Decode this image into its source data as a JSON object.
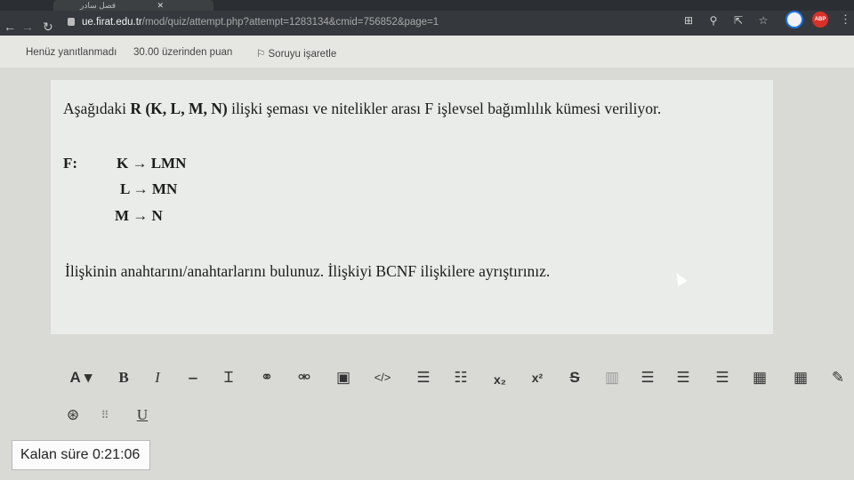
{
  "browser": {
    "tab_title": "فصل سادر",
    "url_host": "ue.firat.edu.tr",
    "url_path": "/mod/quiz/attempt.php?attempt=1283134&cmid=756852&page=1",
    "abp_label": "ABP"
  },
  "question_info": {
    "status": "Henüz yanıtlanmadı",
    "points": "30.00 üzerinden puan",
    "flag": "Soruyu işaretle"
  },
  "question": {
    "intro_before": "Aşağıdaki ",
    "intro_schema": "R (K, L, M, N)",
    "intro_after": " ilişki şeması ve nitelikler arası F işlevsel bağımlılık kümesi veriliyor.",
    "f_label": "F:",
    "dependencies": [
      "K → LMN",
      "L → MN",
      "M → N"
    ],
    "task": "İlişkinin anahtarını/anahtarlarını bulunuz. İlişkiyi BCNF ilişkilere ayrıştırınız."
  },
  "editor": {
    "font_label": "A ▾",
    "bold_label": "B",
    "italic_label": "I",
    "underline_label": "U",
    "subscript_label": "x₂",
    "superscript_label": "x²",
    "code_label": "</>"
  },
  "timer": {
    "label": "Kalan süre 0:21:06"
  }
}
